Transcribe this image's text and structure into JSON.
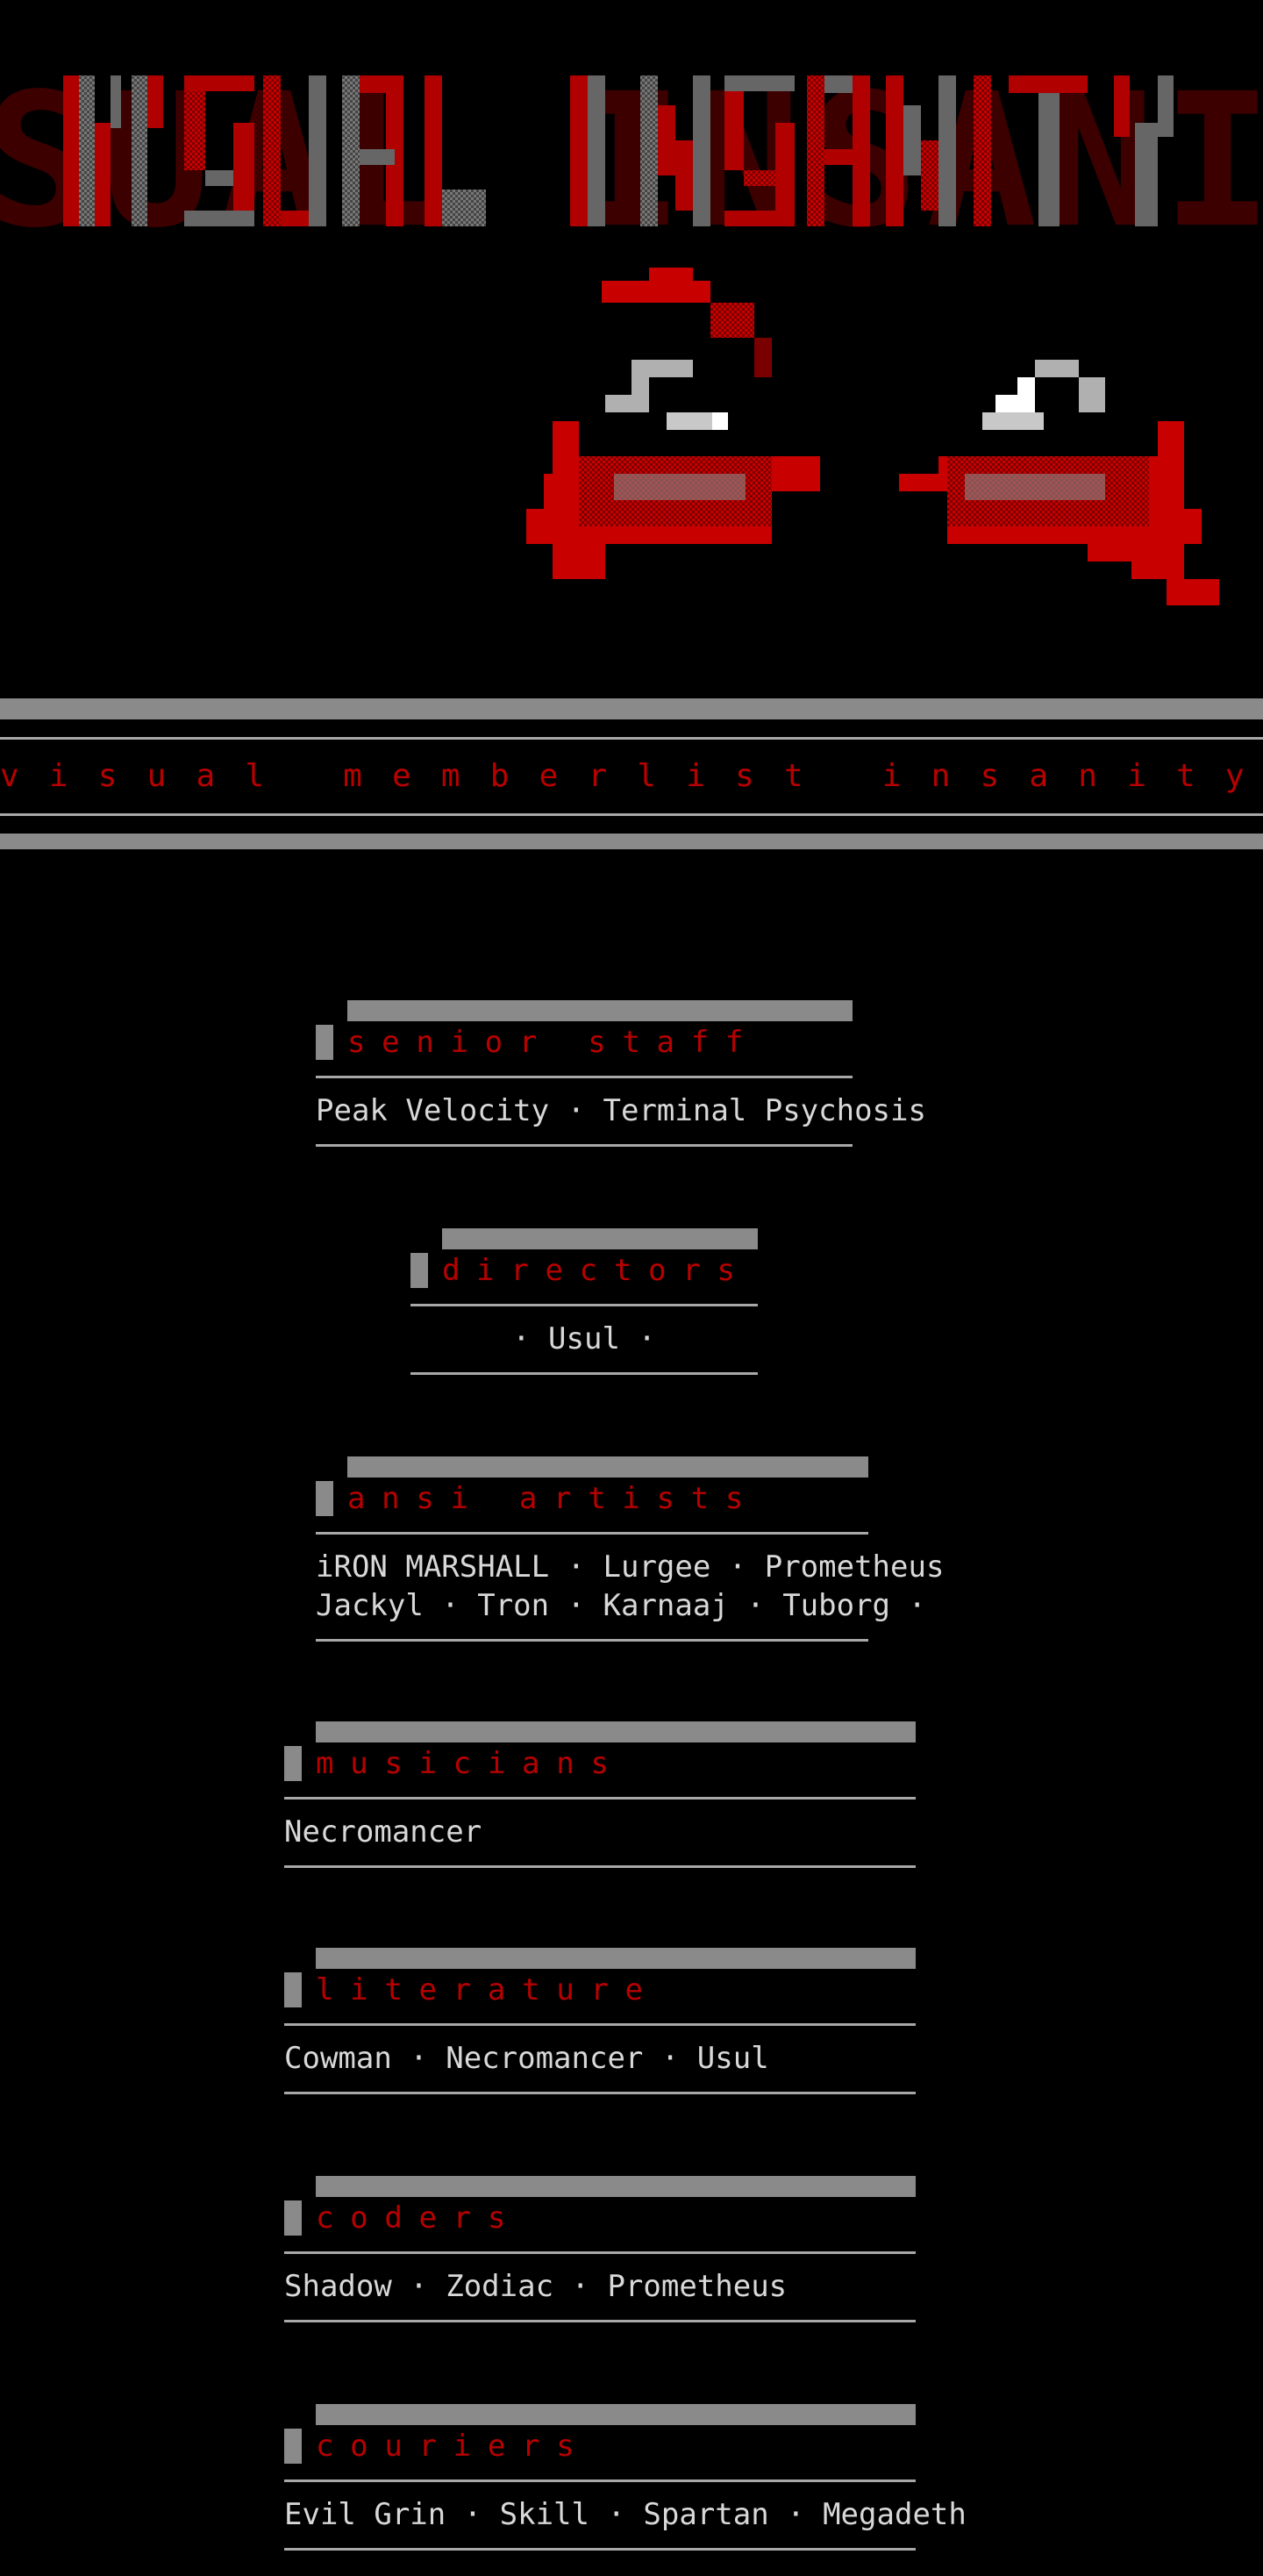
{
  "header": {
    "logo_text": "VISUAL INSANITY",
    "tagline": "visual memberlist insanity"
  },
  "colors": {
    "background": "#000000",
    "accent_red": "#b80000",
    "gray": "#8a8a8a",
    "text": "#d8d8d8"
  },
  "sections": [
    {
      "title": "senior staff",
      "lines": [
        "Peak Velocity · Terminal Psychosis"
      ]
    },
    {
      "title": "directors",
      "lines": [
        "· Usul ·"
      ]
    },
    {
      "title": "ansi artists",
      "lines": [
        "iRON MARSHALL · Lurgee · Prometheus",
        "Jackyl · Tron · Karnaaj · Tuborg ·"
      ]
    },
    {
      "title": "musicians",
      "lines": [
        "Necromancer"
      ]
    },
    {
      "title": "literature",
      "lines": [
        "Cowman · Necromancer · Usul"
      ]
    },
    {
      "title": "coders",
      "lines": [
        "Shadow · Zodiac · Prometheus"
      ]
    },
    {
      "title": "couriers",
      "lines": [
        "Evil Grin · Skill · Spartan · Megadeth"
      ]
    }
  ]
}
